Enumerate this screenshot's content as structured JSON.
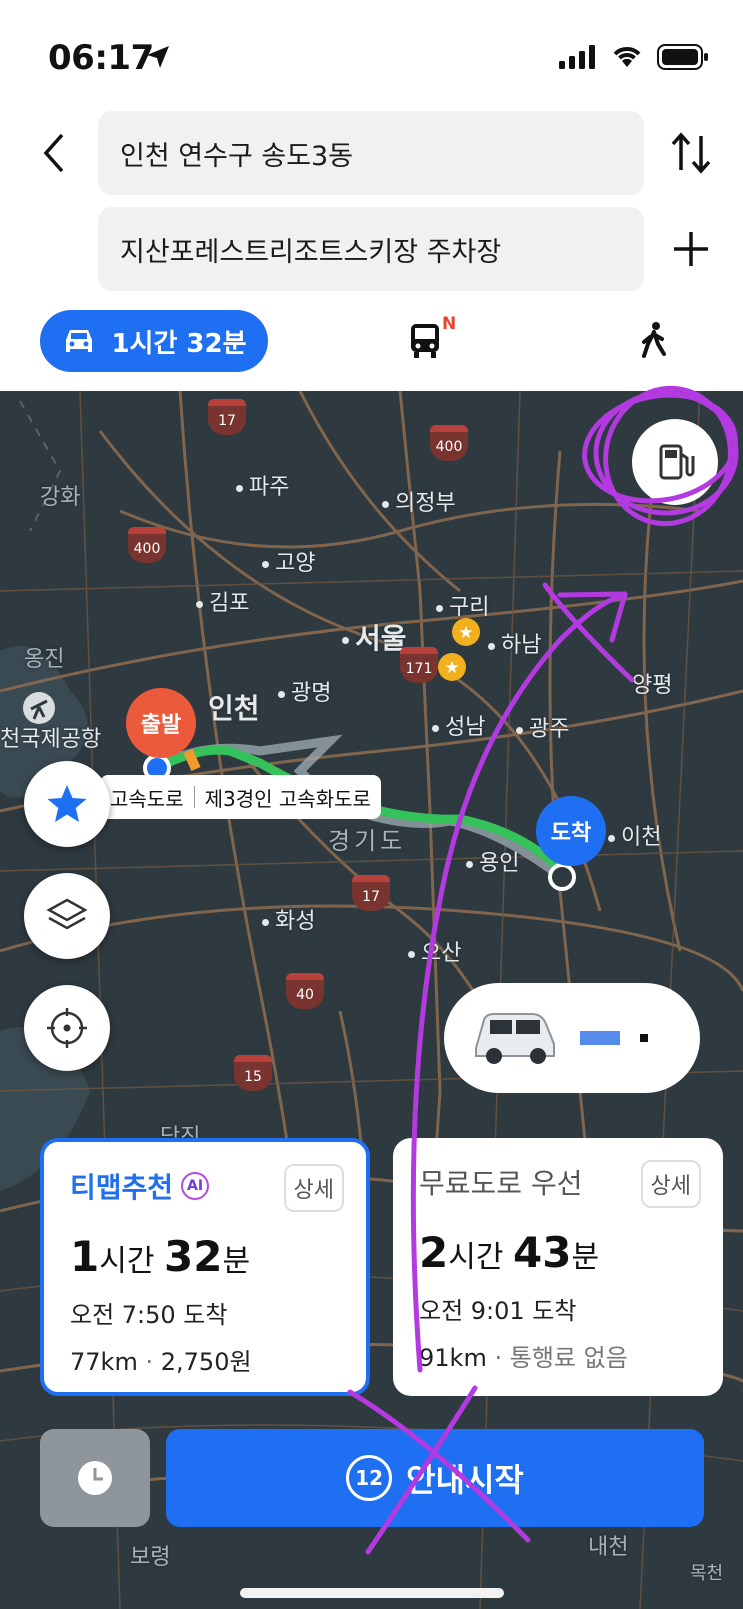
{
  "status": {
    "time": "06:17"
  },
  "search": {
    "from": "인천 연수구 송도3동",
    "to": "지산포레스트리조트스키장 주차장"
  },
  "tabs": {
    "car_label": "1시간 32분",
    "bus_badge": "N"
  },
  "map": {
    "cities": [
      "파주",
      "의정부",
      "강화",
      "고양",
      "김포",
      "구리",
      "서울",
      "하남",
      "옹진",
      "광명",
      "인천",
      "성남",
      "광주",
      "양평",
      "천국제공항",
      "경기도",
      "용인",
      "이천",
      "화성",
      "오산",
      "당진",
      "보령",
      "내천",
      "목천"
    ],
    "highways": [
      "17",
      "400",
      "400",
      "171",
      "17",
      "40",
      "15"
    ],
    "route_label_1": "고속도로",
    "route_label_2": "제3경인 고속화도로",
    "start_pin": "출발",
    "end_pin": "도착"
  },
  "routes": [
    {
      "title": "티맵추천",
      "badge": "AI",
      "detail": "상세",
      "hours": "1",
      "h_unit": "시간",
      "minutes": "32",
      "m_unit": "분",
      "arrival": "오전 7:50 도착",
      "distance": "77km",
      "toll": "2,750원"
    },
    {
      "title": "무료도로 우선",
      "detail": "상세",
      "hours": "2",
      "h_unit": "시간",
      "minutes": "43",
      "m_unit": "분",
      "arrival": "오전 9:01 도착",
      "distance": "91km",
      "toll": "통행료 없음"
    }
  ],
  "start": {
    "countdown": "12",
    "label": "안내시작"
  },
  "colors": {
    "accent": "#1f6ff2",
    "start_pin": "#ec5a3c",
    "annotation": "#b23ae0",
    "map_bg": "#2e3a40"
  }
}
